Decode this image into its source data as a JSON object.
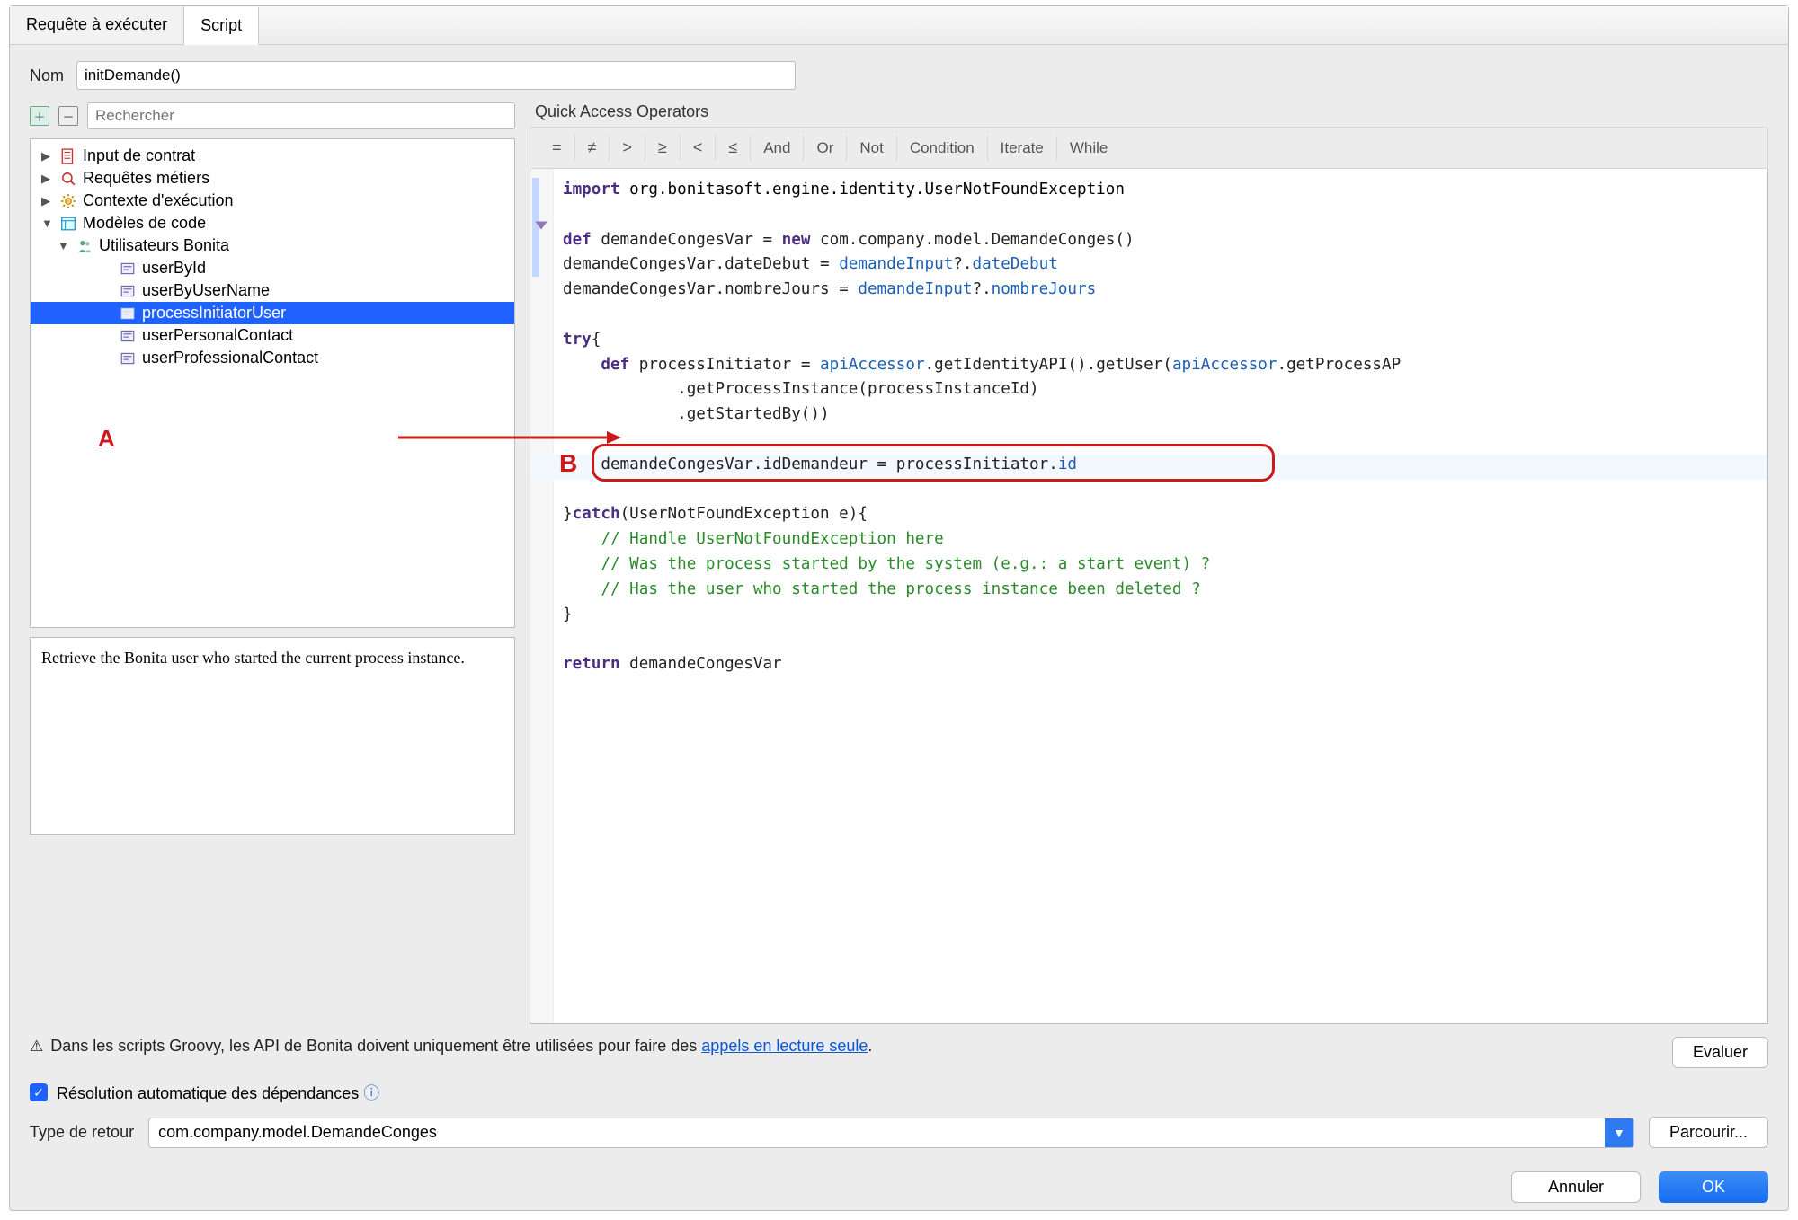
{
  "tabs": {
    "requete": "Requête à exécuter",
    "script": "Script"
  },
  "nom_label": "Nom",
  "nom_value": "initDemande()",
  "search_placeholder": "Rechercher",
  "tree": {
    "input_contrat": "Input de contrat",
    "requetes": "Requêtes métiers",
    "contexte": "Contexte d'exécution",
    "modeles": "Modèles de code",
    "utilisateurs": "Utilisateurs Bonita",
    "items": [
      "userById",
      "userByUserName",
      "processInitiatorUser",
      "userPersonalContact",
      "userProfessionalContact"
    ]
  },
  "description": "Retrieve the Bonita user who started the current process instance.",
  "quick_access_title": "Quick Access Operators",
  "ops": {
    "eq": "=",
    "neq": "≠",
    "gt": ">",
    "gte": "≥",
    "lt": "<",
    "lte": "≤",
    "and": "And",
    "or": "Or",
    "not": "Not",
    "cond": "Condition",
    "iter": "Iterate",
    "while": "While"
  },
  "warning_text_prefix": "Dans les scripts Groovy, les API de Bonita doivent uniquement être utilisées pour faire des ",
  "warning_link": "appels en lecture seule",
  "evaluate_btn": "Evaluer",
  "auto_deps": "Résolution automatique des dépendances",
  "return_label": "Type de retour",
  "return_value": "com.company.model.DemandeConges",
  "parcourir_btn": "Parcourir...",
  "cancel_btn": "Annuler",
  "ok_btn": "OK",
  "annotations": {
    "a": "A",
    "b": "B"
  },
  "code": {
    "l1": {
      "a": "import",
      "b": "org.bonitasoft.engine.identity.UserNotFoundException"
    },
    "l3": {
      "a": "def",
      "b": "demandeCongesVar = ",
      "c": "new",
      "d": " com.company.model.DemandeConges()"
    },
    "l4": {
      "a": "demandeCongesVar.dateDebut = ",
      "b": "demandeInput",
      "c": "?.",
      "d": "dateDebut"
    },
    "l5": {
      "a": "demandeCongesVar.nombreJours = ",
      "b": "demandeInput",
      "c": "?.",
      "d": "nombreJours"
    },
    "l7": {
      "a": "try",
      "b": "{"
    },
    "l8": {
      "a": "    ",
      "b": "def",
      "c": " processInitiator = ",
      "d": "apiAccessor",
      "e": ".getIdentityAPI().getUser(",
      "f": "apiAccessor",
      "g": ".getProcessAP"
    },
    "l9": "            .getProcessInstance(processInstanceId)",
    "l9b": "            .getStartedBy())",
    "l11": {
      "a": "    demandeCongesVar.idDemandeur = processInitiator.",
      "b": "id"
    },
    "l13": {
      "a": "}",
      "b": "catch",
      "c": "(UserNotFoundException e){"
    },
    "l14": "    // Handle UserNotFoundException here",
    "l15": "    // Was the process started by the system (e.g.: a start event) ?",
    "l16": "    // Has the user who started the process instance been deleted ?",
    "l17": "}",
    "l19": {
      "a": "return",
      "b": " demandeCongesVar"
    }
  }
}
